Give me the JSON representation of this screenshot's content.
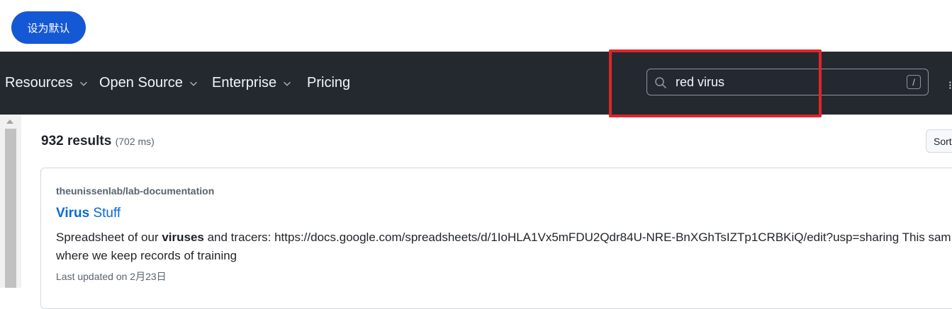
{
  "topbar": {
    "default_button_label": "设为默认"
  },
  "nav": {
    "items": [
      {
        "label": "Resources",
        "dropdown": true
      },
      {
        "label": "Open Source",
        "dropdown": true
      },
      {
        "label": "Enterprise",
        "dropdown": true
      },
      {
        "label": "Pricing",
        "dropdown": false
      }
    ],
    "search": {
      "query": "red virus",
      "shortcut": "/"
    }
  },
  "results": {
    "count_label": "932 results",
    "time_label": "(702 ms)",
    "sort_label": "Sort"
  },
  "result_card": {
    "repo": "theunissenlab/lab-documentation",
    "title_bold": "Virus",
    "title_rest": " Stuff",
    "desc_before": "Spreadsheet of our ",
    "desc_bold": "viruses",
    "desc_after": " and tracers: https://docs.google.com/spreadsheets/d/1IoHLA1Vx5mFDU2Qdr84U-NRE-BnXGhTsIZTp1CRBKiQ/edit?usp=sharing This sam where we keep records of training",
    "updated": "Last updated on 2月23日"
  },
  "colors": {
    "nav_bg": "#24292f",
    "accent_blue": "#0969da",
    "button_blue": "#1558d6",
    "highlight_red": "#e0242a"
  }
}
